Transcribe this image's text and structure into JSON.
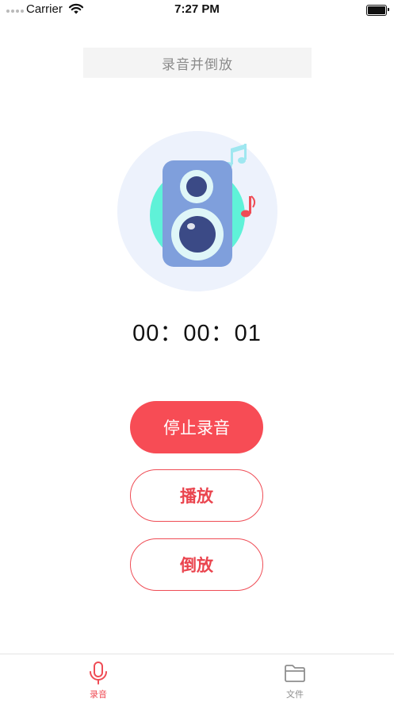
{
  "status_bar": {
    "carrier": "Carrier",
    "time": "7:27 PM"
  },
  "header": {
    "title": "录音并倒放"
  },
  "timer": {
    "display": "00：00：01"
  },
  "buttons": {
    "stop_label": "停止录音",
    "play_label": "播放",
    "reverse_label": "倒放"
  },
  "tab_bar": {
    "tabs": [
      {
        "label": "录音",
        "icon": "microphone-icon",
        "active": true
      },
      {
        "label": "文件",
        "icon": "folder-icon",
        "active": false
      }
    ]
  },
  "colors": {
    "accent": "#f74c55",
    "speaker_body": "#7f9fdc",
    "speaker_cone": "#3b4a86",
    "circle_bg": "#edf2fc",
    "teal_accent": "#5ff2d8",
    "inactive_tab": "#8e8e8e"
  }
}
